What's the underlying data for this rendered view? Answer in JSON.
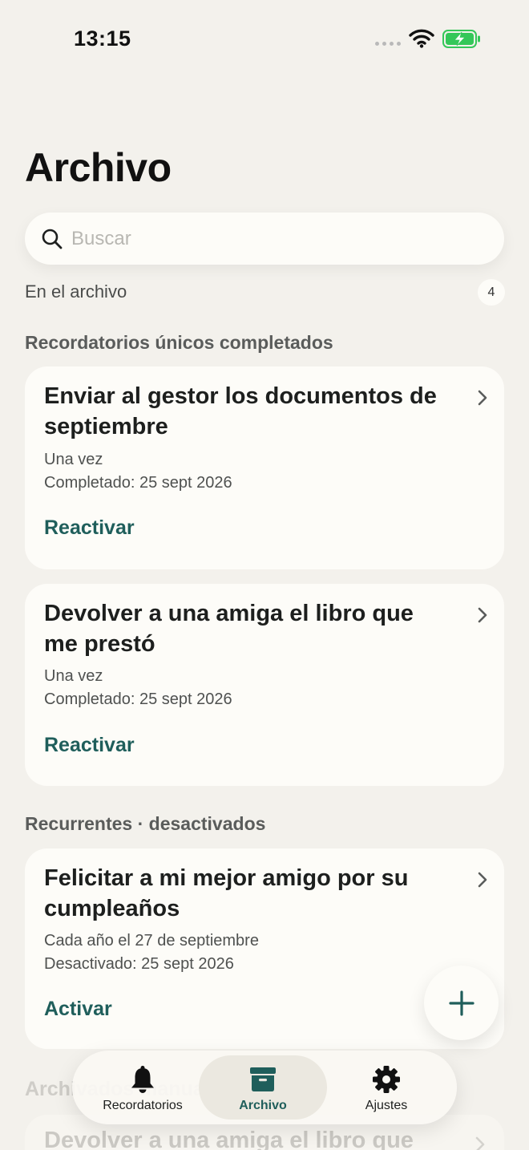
{
  "status_bar": {
    "time": "13:15"
  },
  "page": {
    "title": "Archivo"
  },
  "search": {
    "placeholder": "Buscar",
    "value": ""
  },
  "archive_summary": {
    "label": "En el archivo",
    "count": "4"
  },
  "sections": [
    {
      "header": "Recordatorios únicos completados",
      "cards": [
        {
          "title": "Enviar al gestor los documentos de septiembre",
          "frequency": "Una vez",
          "status": "Completado: 25 sept 2026",
          "action": "Reactivar"
        },
        {
          "title": "Devolver a una amiga el libro que me prestó",
          "frequency": "Una vez",
          "status": "Completado: 25 sept 2026",
          "action": "Reactivar"
        }
      ]
    },
    {
      "header": "Recurrentes · desactivados",
      "cards": [
        {
          "title": "Felicitar a mi mejor amigo por su cumpleaños",
          "frequency": "Cada año el 27 de septiembre",
          "status": "Desactivado: 25 sept 2026",
          "action": "Activar"
        }
      ]
    },
    {
      "header": "Archivados manualmente",
      "cards": [
        {
          "title": "Devolver a una amiga el libro que"
        }
      ]
    }
  ],
  "tab_bar": {
    "active": "archivo",
    "tabs": [
      {
        "label": "Recordatorios",
        "icon": "bell-icon"
      },
      {
        "label": "Archivo",
        "icon": "archive-box-icon"
      },
      {
        "label": "Ajustes",
        "icon": "gear-icon"
      }
    ]
  },
  "colors": {
    "accent": "#1f5e5b",
    "background": "#f3f1ec",
    "card": "#fdfcf8",
    "battery": "#34c759"
  }
}
